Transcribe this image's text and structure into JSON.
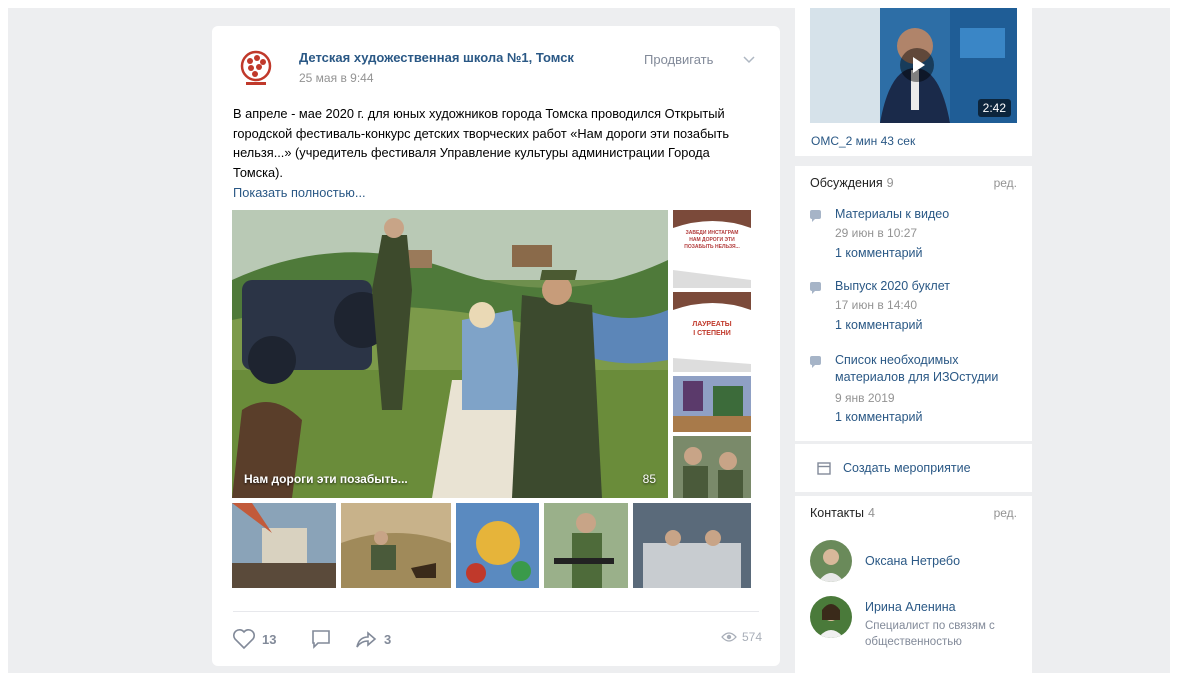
{
  "post": {
    "author": "Детская художественная школа №1, Томск",
    "date": "25 мая в 9:44",
    "promote_label": "Продвигать",
    "text": "В апреле - мае 2020 г. для юных художников города Томска проводился Открытый городской фестиваль-конкурс детских творческих работ «Нам дороги эти позабыть нельзя...» (учредитель фестиваля Управление культуры администрации Города Томска).",
    "show_full": "Показать полностью...",
    "photo_caption": "Нам дороги эти позабыть...",
    "photo_count": "85",
    "side_thumbs": [
      {
        "lines": [
          "ЗАВЕДИ ИНСТАГРАМ",
          "НАМ ДОРОГИ ЭТИ",
          "ПОЗАБЫТЬ НЕЛЬЗЯ..."
        ]
      },
      {
        "lines": [
          "ЛАУРЕАТЫ",
          "I СТЕПЕНИ"
        ]
      }
    ],
    "likes": "13",
    "shares": "3",
    "views": "574"
  },
  "video": {
    "title": "ОМС_2 мин 43 сек",
    "duration": "2:42"
  },
  "discussions": {
    "header": "Обсуждения",
    "count": "9",
    "edit": "ред.",
    "items": [
      {
        "title": "Материалы к видео",
        "date": "29 июн в 10:27",
        "comments": "1 комментарий"
      },
      {
        "title": "Выпуск 2020 буклет",
        "date": "17 июн в 14:40",
        "comments": "1 комментарий"
      },
      {
        "title": "Список необходимых материалов для ИЗОстудии",
        "date": "9 янв 2019",
        "comments": "1 комментарий"
      }
    ]
  },
  "event": {
    "label": "Создать мероприятие"
  },
  "contacts": {
    "header": "Контакты",
    "count": "4",
    "edit": "ред.",
    "items": [
      {
        "name": "Оксана Нетребо",
        "role": ""
      },
      {
        "name": "Ирина Аленина",
        "role": "Специалист по связям с общественностью"
      }
    ]
  },
  "colors": {
    "link": "#2a5885",
    "muted": "#939393",
    "background": "#edeef0"
  }
}
